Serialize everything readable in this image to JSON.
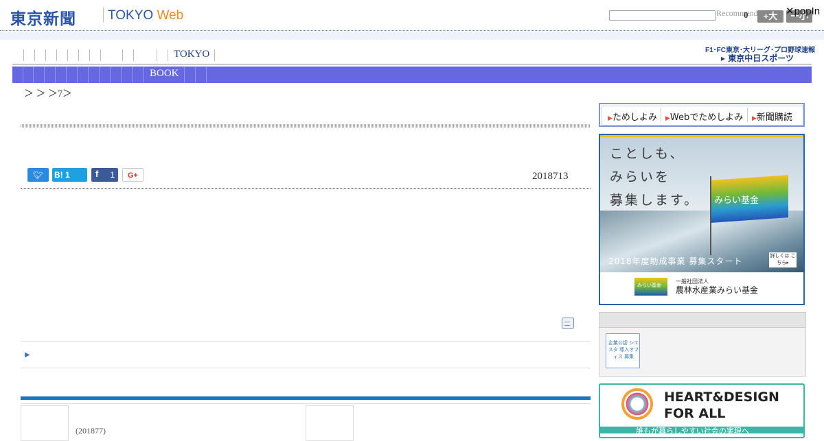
{
  "header": {
    "logo_jp": "東京新聞",
    "logo_tokyo": "TOKYO ",
    "logo_web": "Web",
    "recommend_label": "Recommend",
    "recommend_count": "0",
    "size_up_label": "+大",
    "size_down_label": "ー小",
    "popin_label": "popIn"
  },
  "nav": {
    "tokyo_label": "TOKYO",
    "f1_label": "F1･FC東京･大リーグ･プロ野球速報",
    "chunichi_label": "▸ 東京中日スポーツ",
    "book_label": "BOOK"
  },
  "breadcrumb": "＞ ＞ ＞7＞",
  "article": {
    "share_hatena_count": "1",
    "share_facebook_count": "1",
    "share_google_label": "G+",
    "date": "2018713",
    "caption": "(201877)"
  },
  "sidebar": {
    "menu": [
      "ためしよみ",
      "Webでためしよみ",
      "新聞購読"
    ],
    "ad": {
      "line1": "ことしも、",
      "line2": "みらいを",
      "line3": "募集します。",
      "flag_text": "みらい基金",
      "year_text": "2018年度助成事業 募集スタート",
      "detail_text": "詳しくは こちら▸",
      "org_small": "一般社団法人",
      "org_name": "農林水産業みらい基金",
      "logo_text": "みらい基金"
    },
    "panel_icon_text": "企業公認 シエスタ 導入オフィス 募集",
    "heart_line1": "HEART&DESIGN",
    "heart_line2": "FOR ALL",
    "heart_sub": "誰もが暮らしやすい社会の実現へ"
  },
  "colors": {
    "brand_blue": "#2a55a6",
    "brand_orange": "#f08a1c",
    "subnav": "#6568e0",
    "accent_bar": "#1d74c4"
  }
}
